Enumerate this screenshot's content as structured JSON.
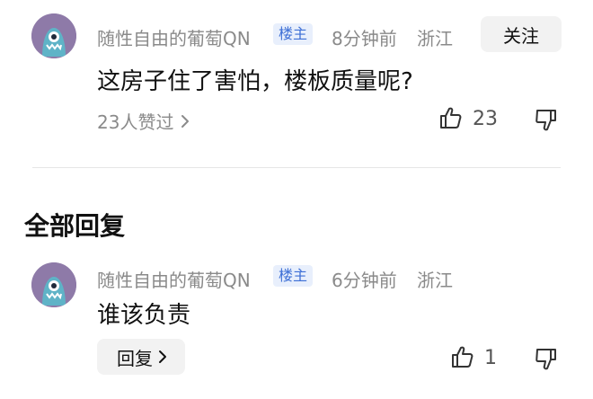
{
  "top_comment": {
    "username": "随性自由的葡萄QN",
    "badge": "楼主",
    "time": "8分钟前",
    "location": "浙江",
    "follow_label": "关注",
    "text": "这房子住了害怕，楼板质量呢?",
    "likes_summary": "23人赞过",
    "like_count": "23"
  },
  "section_title": "全部回复",
  "reply": {
    "username": "随性自由的葡萄QN",
    "badge": "楼主",
    "time": "6分钟前",
    "location": "浙江",
    "text": "谁该负责",
    "reply_label": "回复",
    "like_count": "1"
  },
  "colors": {
    "avatar": "#8e7aa8",
    "badge_text": "#3d6fd6",
    "badge_bg": "#e8effc",
    "meta_text": "#8a8a8a"
  },
  "icons": [
    "avatar-monster-icon",
    "chevron-right-icon",
    "thumbs-up-icon",
    "thumbs-down-icon"
  ]
}
